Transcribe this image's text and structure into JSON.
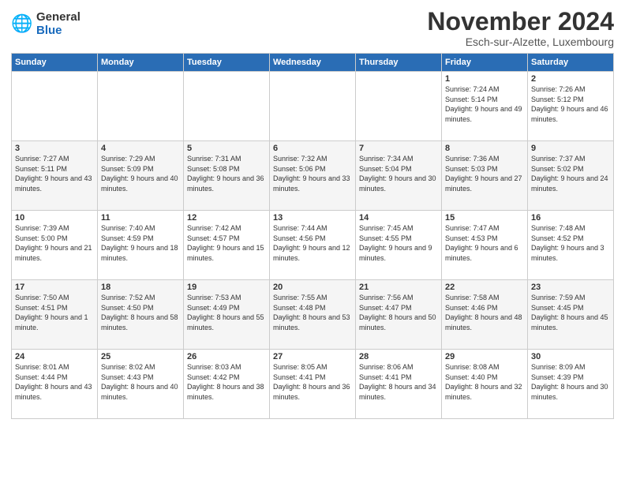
{
  "logo": {
    "general": "General",
    "blue": "Blue"
  },
  "title": "November 2024",
  "location": "Esch-sur-Alzette, Luxembourg",
  "days_of_week": [
    "Sunday",
    "Monday",
    "Tuesday",
    "Wednesday",
    "Thursday",
    "Friday",
    "Saturday"
  ],
  "weeks": [
    [
      {
        "day": "",
        "info": ""
      },
      {
        "day": "",
        "info": ""
      },
      {
        "day": "",
        "info": ""
      },
      {
        "day": "",
        "info": ""
      },
      {
        "day": "",
        "info": ""
      },
      {
        "day": "1",
        "info": "Sunrise: 7:24 AM\nSunset: 5:14 PM\nDaylight: 9 hours and 49 minutes."
      },
      {
        "day": "2",
        "info": "Sunrise: 7:26 AM\nSunset: 5:12 PM\nDaylight: 9 hours and 46 minutes."
      }
    ],
    [
      {
        "day": "3",
        "info": "Sunrise: 7:27 AM\nSunset: 5:11 PM\nDaylight: 9 hours and 43 minutes."
      },
      {
        "day": "4",
        "info": "Sunrise: 7:29 AM\nSunset: 5:09 PM\nDaylight: 9 hours and 40 minutes."
      },
      {
        "day": "5",
        "info": "Sunrise: 7:31 AM\nSunset: 5:08 PM\nDaylight: 9 hours and 36 minutes."
      },
      {
        "day": "6",
        "info": "Sunrise: 7:32 AM\nSunset: 5:06 PM\nDaylight: 9 hours and 33 minutes."
      },
      {
        "day": "7",
        "info": "Sunrise: 7:34 AM\nSunset: 5:04 PM\nDaylight: 9 hours and 30 minutes."
      },
      {
        "day": "8",
        "info": "Sunrise: 7:36 AM\nSunset: 5:03 PM\nDaylight: 9 hours and 27 minutes."
      },
      {
        "day": "9",
        "info": "Sunrise: 7:37 AM\nSunset: 5:02 PM\nDaylight: 9 hours and 24 minutes."
      }
    ],
    [
      {
        "day": "10",
        "info": "Sunrise: 7:39 AM\nSunset: 5:00 PM\nDaylight: 9 hours and 21 minutes."
      },
      {
        "day": "11",
        "info": "Sunrise: 7:40 AM\nSunset: 4:59 PM\nDaylight: 9 hours and 18 minutes."
      },
      {
        "day": "12",
        "info": "Sunrise: 7:42 AM\nSunset: 4:57 PM\nDaylight: 9 hours and 15 minutes."
      },
      {
        "day": "13",
        "info": "Sunrise: 7:44 AM\nSunset: 4:56 PM\nDaylight: 9 hours and 12 minutes."
      },
      {
        "day": "14",
        "info": "Sunrise: 7:45 AM\nSunset: 4:55 PM\nDaylight: 9 hours and 9 minutes."
      },
      {
        "day": "15",
        "info": "Sunrise: 7:47 AM\nSunset: 4:53 PM\nDaylight: 9 hours and 6 minutes."
      },
      {
        "day": "16",
        "info": "Sunrise: 7:48 AM\nSunset: 4:52 PM\nDaylight: 9 hours and 3 minutes."
      }
    ],
    [
      {
        "day": "17",
        "info": "Sunrise: 7:50 AM\nSunset: 4:51 PM\nDaylight: 9 hours and 1 minute."
      },
      {
        "day": "18",
        "info": "Sunrise: 7:52 AM\nSunset: 4:50 PM\nDaylight: 8 hours and 58 minutes."
      },
      {
        "day": "19",
        "info": "Sunrise: 7:53 AM\nSunset: 4:49 PM\nDaylight: 8 hours and 55 minutes."
      },
      {
        "day": "20",
        "info": "Sunrise: 7:55 AM\nSunset: 4:48 PM\nDaylight: 8 hours and 53 minutes."
      },
      {
        "day": "21",
        "info": "Sunrise: 7:56 AM\nSunset: 4:47 PM\nDaylight: 8 hours and 50 minutes."
      },
      {
        "day": "22",
        "info": "Sunrise: 7:58 AM\nSunset: 4:46 PM\nDaylight: 8 hours and 48 minutes."
      },
      {
        "day": "23",
        "info": "Sunrise: 7:59 AM\nSunset: 4:45 PM\nDaylight: 8 hours and 45 minutes."
      }
    ],
    [
      {
        "day": "24",
        "info": "Sunrise: 8:01 AM\nSunset: 4:44 PM\nDaylight: 8 hours and 43 minutes."
      },
      {
        "day": "25",
        "info": "Sunrise: 8:02 AM\nSunset: 4:43 PM\nDaylight: 8 hours and 40 minutes."
      },
      {
        "day": "26",
        "info": "Sunrise: 8:03 AM\nSunset: 4:42 PM\nDaylight: 8 hours and 38 minutes."
      },
      {
        "day": "27",
        "info": "Sunrise: 8:05 AM\nSunset: 4:41 PM\nDaylight: 8 hours and 36 minutes."
      },
      {
        "day": "28",
        "info": "Sunrise: 8:06 AM\nSunset: 4:41 PM\nDaylight: 8 hours and 34 minutes."
      },
      {
        "day": "29",
        "info": "Sunrise: 8:08 AM\nSunset: 4:40 PM\nDaylight: 8 hours and 32 minutes."
      },
      {
        "day": "30",
        "info": "Sunrise: 8:09 AM\nSunset: 4:39 PM\nDaylight: 8 hours and 30 minutes."
      }
    ]
  ]
}
